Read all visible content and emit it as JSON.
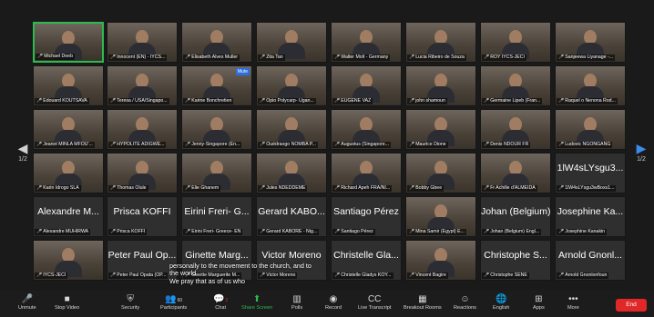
{
  "participants": [
    {
      "label": "Michael Deeb",
      "video": true,
      "speaking": true
    },
    {
      "label": "Innocent (EN) - IYCS...",
      "video": true
    },
    {
      "label": "Elisabeth Alves Muller",
      "video": true
    },
    {
      "label": "Zita Tan",
      "video": true
    },
    {
      "label": "Walter Molt - Germany",
      "video": true
    },
    {
      "label": "Lucia Ribeiro de Souza",
      "video": true
    },
    {
      "label": "ROY IYCS-JECI",
      "video": true
    },
    {
      "label": "Sanjeewa Liyanage -...",
      "video": true
    },
    {
      "label": "Edouard KOUTSAVA",
      "video": true
    },
    {
      "label": "Teresa / USA/Singapo...",
      "video": true
    },
    {
      "label": "Karine Bonchretien",
      "video": true,
      "tag": "Mute"
    },
    {
      "label": "Opio Polycarp- Ugan...",
      "video": true
    },
    {
      "label": "EUGENE VAZ",
      "video": true
    },
    {
      "label": "john shamoun",
      "video": true
    },
    {
      "label": "Germaine Lipeb (Fran...",
      "video": true
    },
    {
      "label": "Raquel o Nenona Rod...",
      "video": true
    },
    {
      "label": "Jeanot MINLA MFOU'...",
      "video": true
    },
    {
      "label": "HYPOLITE ADIGWE...",
      "video": true
    },
    {
      "label": "Jenny-Singapore (En...",
      "video": true
    },
    {
      "label": "Ouédraogo NOMBA P...",
      "video": true
    },
    {
      "label": "Augustus (Singapore...",
      "video": true
    },
    {
      "label": "Maurice Dione",
      "video": true
    },
    {
      "label": "Denis NDOUR FR",
      "video": true
    },
    {
      "label": "Ludovic NGONGANG",
      "video": true
    },
    {
      "label": "Karin Idrogo SLA",
      "video": true
    },
    {
      "label": "Thomas Olule",
      "video": true
    },
    {
      "label": "Elie Ghanem",
      "video": true
    },
    {
      "label": "Jules NDEDDEME",
      "video": true
    },
    {
      "label": "Richard Apeh FRA/NI...",
      "video": true
    },
    {
      "label": "Bobby Gbee",
      "video": true
    },
    {
      "label": "Fr Achille d'ALMEIDA",
      "video": true
    },
    {
      "label": "1lW4sLYsgu3wBoxs1...",
      "big": "1lW4sLYsgu3..."
    },
    {
      "label": "Alexandre MUHIRWA",
      "big": "Alexandre M..."
    },
    {
      "label": "Prisca KOFFI",
      "big": "Prisca KOFFI"
    },
    {
      "label": "Eirini Freri- Greece- EN",
      "big": "Eirini Freri- G..."
    },
    {
      "label": "Gerard KABORE - Nig...",
      "big": "Gerard KABO..."
    },
    {
      "label": "Santiago Pérez",
      "big": "Santiago Pérez"
    },
    {
      "label": "Mina Samir (Egypt) E...",
      "video": true
    },
    {
      "label": "Johan (Belgium) Engl...",
      "big": "Johan (Belgium)"
    },
    {
      "label": "Josephine Kanakin",
      "big": "Josephine Ka..."
    },
    {
      "label": "IYCS-JECI",
      "video": true
    },
    {
      "label": "Peter Paul Opata (OP...",
      "big": "Peter Paul Op..."
    },
    {
      "label": "Ginette Marguerite M...",
      "big": "Ginette Marg..."
    },
    {
      "label": "Victor Moreno",
      "big": "Victor Moreno"
    },
    {
      "label": "Christelle Gladys KOY...",
      "big": "Christelle Gla..."
    },
    {
      "label": "Vincent Bagire",
      "video": true
    },
    {
      "label": "Christophe SENE",
      "big": "Christophe S..."
    },
    {
      "label": "Arnold Gnonlonfoun",
      "big": "Arnold Gnonl..."
    }
  ],
  "pager": {
    "left_label": "1/2",
    "right_label": "1/2"
  },
  "caption": {
    "line1": "personally to the movement to the church, and to",
    "line2": "the world,",
    "line3": "We pray that as of us who"
  },
  "toolbar": {
    "unmute": "Unmute",
    "stop_video": "Stop Video",
    "security": "Security",
    "participants": "Participants",
    "participants_count": "60",
    "chat": "Chat",
    "chat_badge": "2",
    "share_screen": "Share Screen",
    "polls": "Polls",
    "record": "Record",
    "live_transcript": "Live Transcript",
    "breakout_rooms": "Breakout Rooms",
    "reactions": "Reactions",
    "english": "English",
    "apps": "Apps",
    "more": "More",
    "end": "End"
  },
  "colors": {
    "speaker_border": "#2dbb4e",
    "end_button": "#e02828",
    "share_screen": "#2dbb4e"
  }
}
